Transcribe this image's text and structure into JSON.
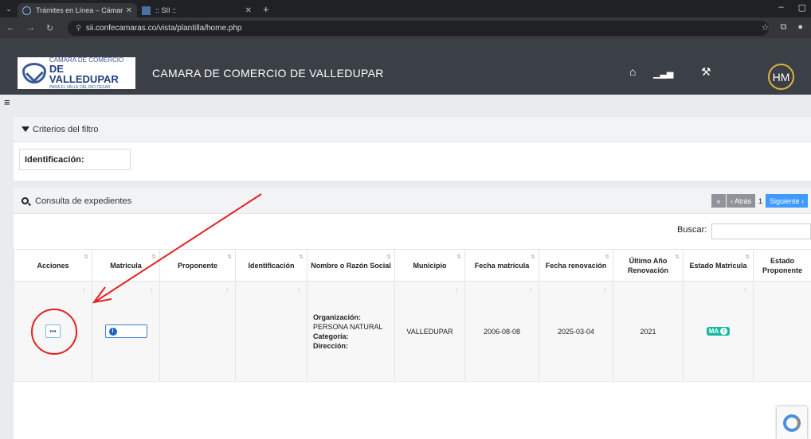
{
  "browser": {
    "tabs": [
      {
        "title": "Trámites en Línea – Cámara de",
        "active": true
      },
      {
        "title": ":: SII ::",
        "active": false
      }
    ],
    "url": "sii.confecamaras.co/vista/plantilla/home.php"
  },
  "header": {
    "logo": {
      "line1": "CÁMARA DE COMERCIO",
      "line2": "DE VALLEDUPAR",
      "line3": "PARA EL VALLE DEL RÍO CESAR"
    },
    "title": "CAMARA DE COMERCIO DE VALLEDUPAR",
    "avatar_initials": "HM"
  },
  "filter": {
    "heading": "Criterios del filtro",
    "id_label": "Identificación:"
  },
  "consulta": {
    "heading": "Consulta de expedientes",
    "pager": {
      "prev_label": "‹ Atrás",
      "page": "1",
      "next_label": "Siguiente ›"
    },
    "search_label": "Buscar:",
    "columns": [
      "Acciones",
      "Matricula",
      "Proponente",
      "Identificación",
      "Nombre o Razón Social",
      "Municipio",
      "Fecha matricula",
      "Fecha renovación",
      "Último Año Renovación",
      "Estado Matricula",
      "Estado Proponente"
    ],
    "row": {
      "org_label": "Organización:",
      "org_value": "PERSONA NATURAL",
      "cat_label": "Categoría:",
      "dir_label": "Dirección:",
      "municipio": "VALLEDUPAR",
      "fecha_matricula": "2006-08-08",
      "fecha_renovacion": "2025-03-04",
      "ultimo_anio": "2021",
      "estado_matricula": "MA"
    }
  },
  "colors": {
    "annotation": "#e62020",
    "next_button": "#3e9bff",
    "badge": "#18b8a0"
  }
}
